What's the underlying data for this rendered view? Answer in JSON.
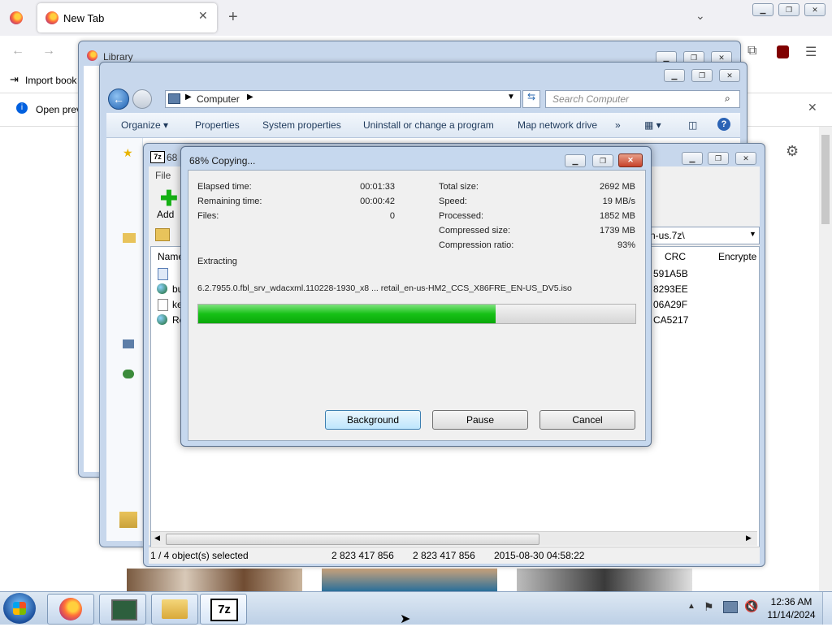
{
  "firefox": {
    "tab_title": "New Tab",
    "bookmark": "Import book",
    "notice": "Open prev"
  },
  "library": {
    "title": "Library"
  },
  "explorer": {
    "location": "Computer",
    "search_placeholder": "Search Computer",
    "toolbar": [
      "Organize ▾",
      "Properties",
      "System properties",
      "Uninstall or change a program",
      "Map network drive",
      "»"
    ]
  },
  "sevenzip": {
    "title": "68",
    "menu_file": "File",
    "add_label": "Add",
    "path_tail": "n-us.7z\\",
    "columns": {
      "name": "Name",
      "crc": "CRC",
      "encrypted": "Encrypte"
    },
    "rows": [
      {
        "name": "",
        "crc": "591A5B"
      },
      {
        "name": "bu",
        "crc": "8293EE"
      },
      {
        "name": "key",
        "crc": "06A29F"
      },
      {
        "name": "Re",
        "crc": "CA5217"
      }
    ],
    "status": {
      "selected": "1 / 4 object(s) selected",
      "size": "2 823 417 856",
      "packed": "2 823 417 856",
      "modified": "2015-08-30 04:58:22"
    }
  },
  "dialog": {
    "title": "68% Copying...",
    "elapsed_label": "Elapsed time:",
    "elapsed": "00:01:33",
    "remaining_label": "Remaining time:",
    "remaining": "00:00:42",
    "files_label": "Files:",
    "files": "0",
    "total_label": "Total size:",
    "total": "2692 MB",
    "speed_label": "Speed:",
    "speed": "19 MB/s",
    "processed_label": "Processed:",
    "processed": "1852 MB",
    "compressed_label": "Compressed size:",
    "compressed": "1739 MB",
    "ratio_label": "Compression ratio:",
    "ratio": "93%",
    "operation": "Extracting",
    "file_path": "6.2.7955.0.fbl_srv_wdacxml.110228-1930_x8 ... retail_en-us-HM2_CCS_X86FRE_EN-US_DV5.iso",
    "progress_fraction": 0.68,
    "btn_background": "Background",
    "btn_pause": "Pause",
    "btn_cancel": "Cancel"
  },
  "taskbar": {
    "time": "12:36 AM",
    "date": "11/14/2024",
    "sevenzip_icon_text": "7z"
  },
  "colors": {
    "progress": "#16c116",
    "aero": "#c7d7ec",
    "taskbar": "#c6d7ec"
  }
}
